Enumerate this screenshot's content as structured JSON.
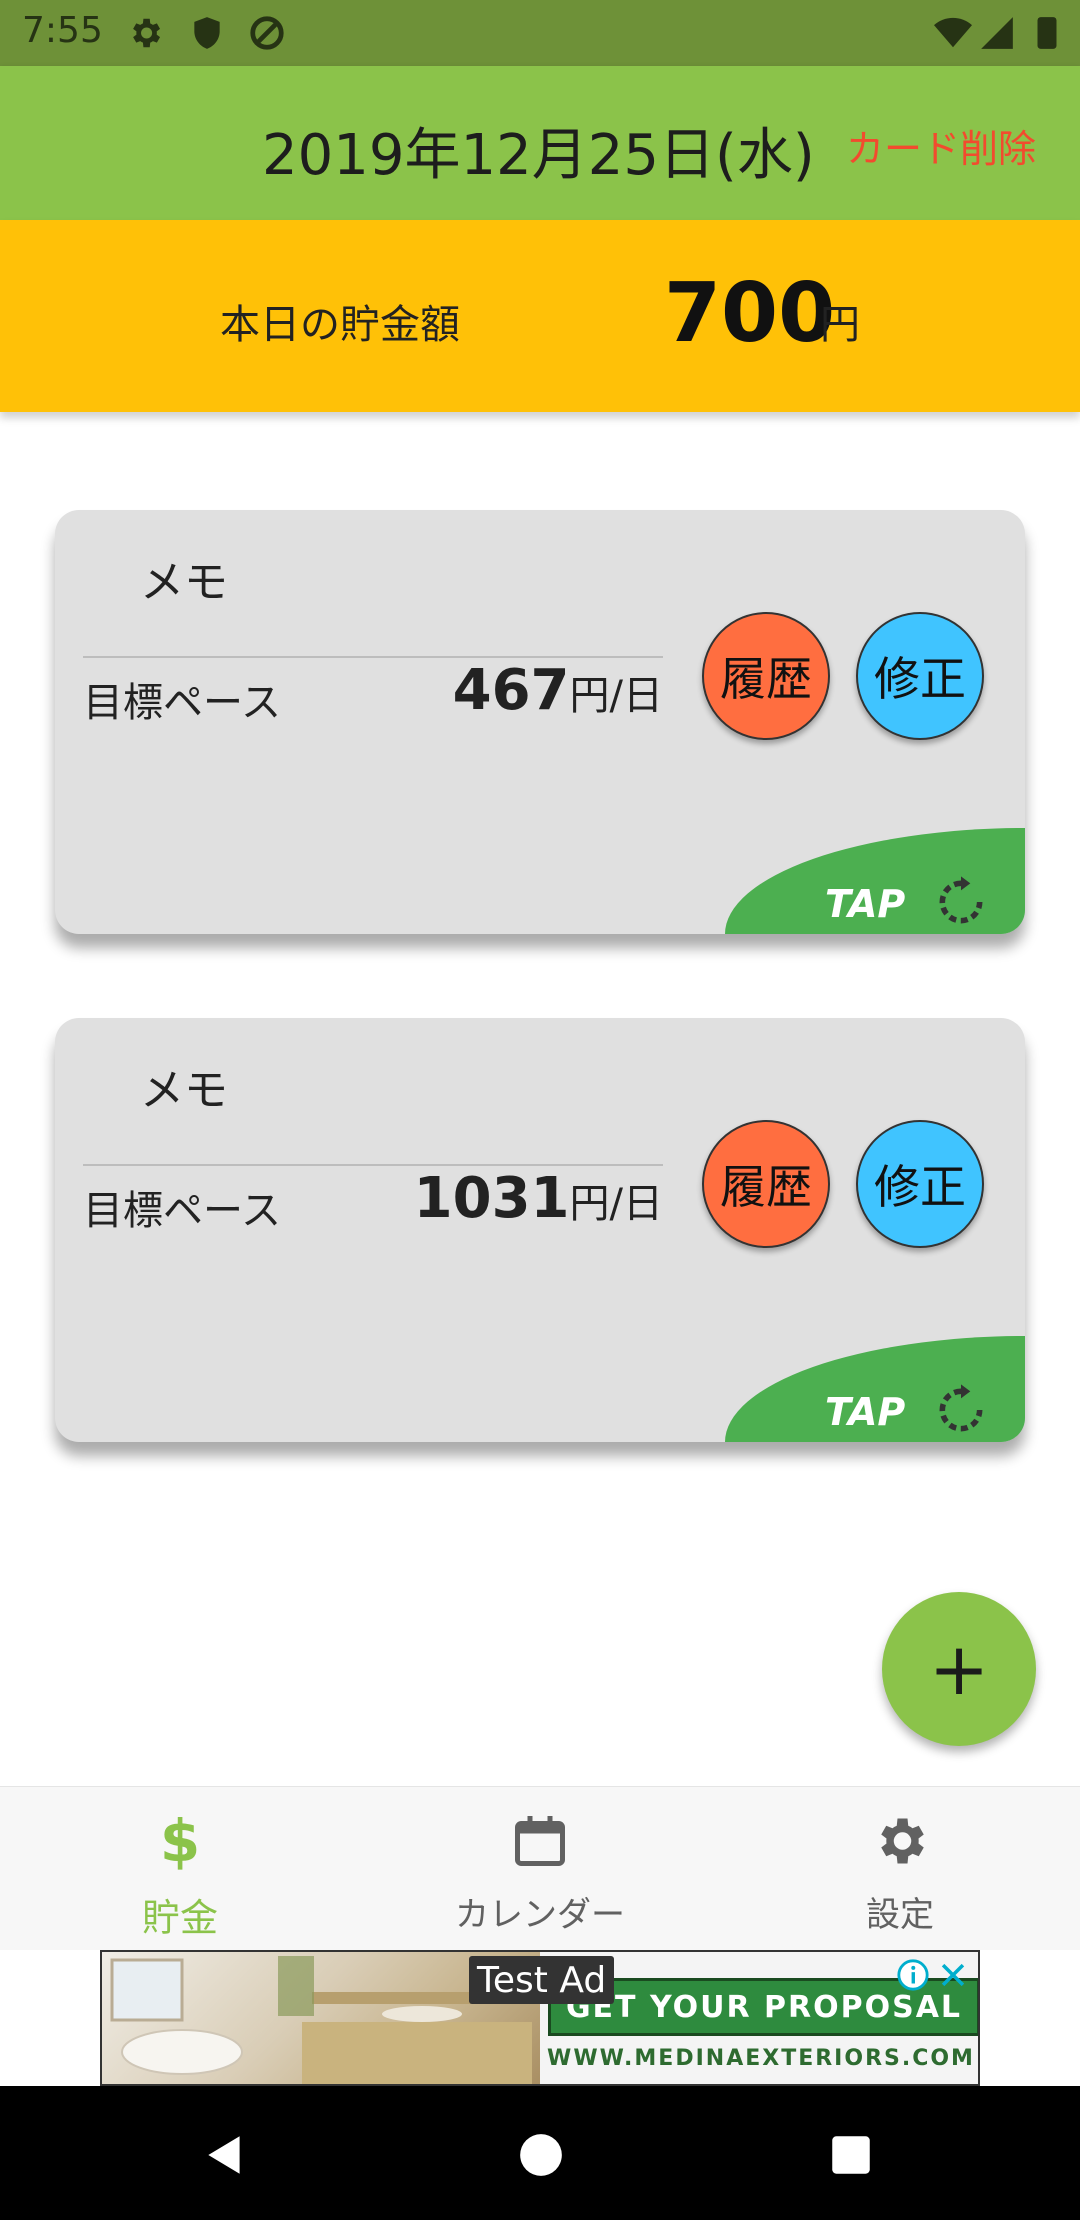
{
  "status_bar": {
    "time": "7:55"
  },
  "app_bar": {
    "date": "2019年12月25日(水)",
    "delete_card": "カード削除"
  },
  "summary": {
    "label": "本日の貯金額",
    "amount": "700",
    "unit": "円"
  },
  "cards": [
    {
      "memo": "メモ",
      "goal_label": "目標ペース",
      "goal_value": "467",
      "goal_unit": "円/日",
      "history_label": "履歴",
      "edit_label": "修正",
      "tap_label": "TAP"
    },
    {
      "memo": "メモ",
      "goal_label": "目標ペース",
      "goal_value": "1031",
      "goal_unit": "円/日",
      "history_label": "履歴",
      "edit_label": "修正",
      "tap_label": "TAP"
    }
  ],
  "fab": {
    "label": "+"
  },
  "bottom_nav": {
    "items": [
      {
        "label": "貯金",
        "icon": "dollar-icon",
        "active": true
      },
      {
        "label": "カレンダー",
        "icon": "calendar-icon",
        "active": false
      },
      {
        "label": "設定",
        "icon": "gear-icon",
        "active": false
      }
    ]
  },
  "ad": {
    "tag": "Test Ad",
    "cta": "GET YOUR PROPOSAL",
    "url": "WWW.MEDINAEXTERIORS.COM"
  },
  "colors": {
    "app_bar": "#8BC34A",
    "status_bar": "#6E9138",
    "summary": "#FFC107",
    "history": "#FF6E40",
    "edit": "#40C4FF",
    "tap": "#4CAF50",
    "delete_text": "#F24B2E"
  }
}
